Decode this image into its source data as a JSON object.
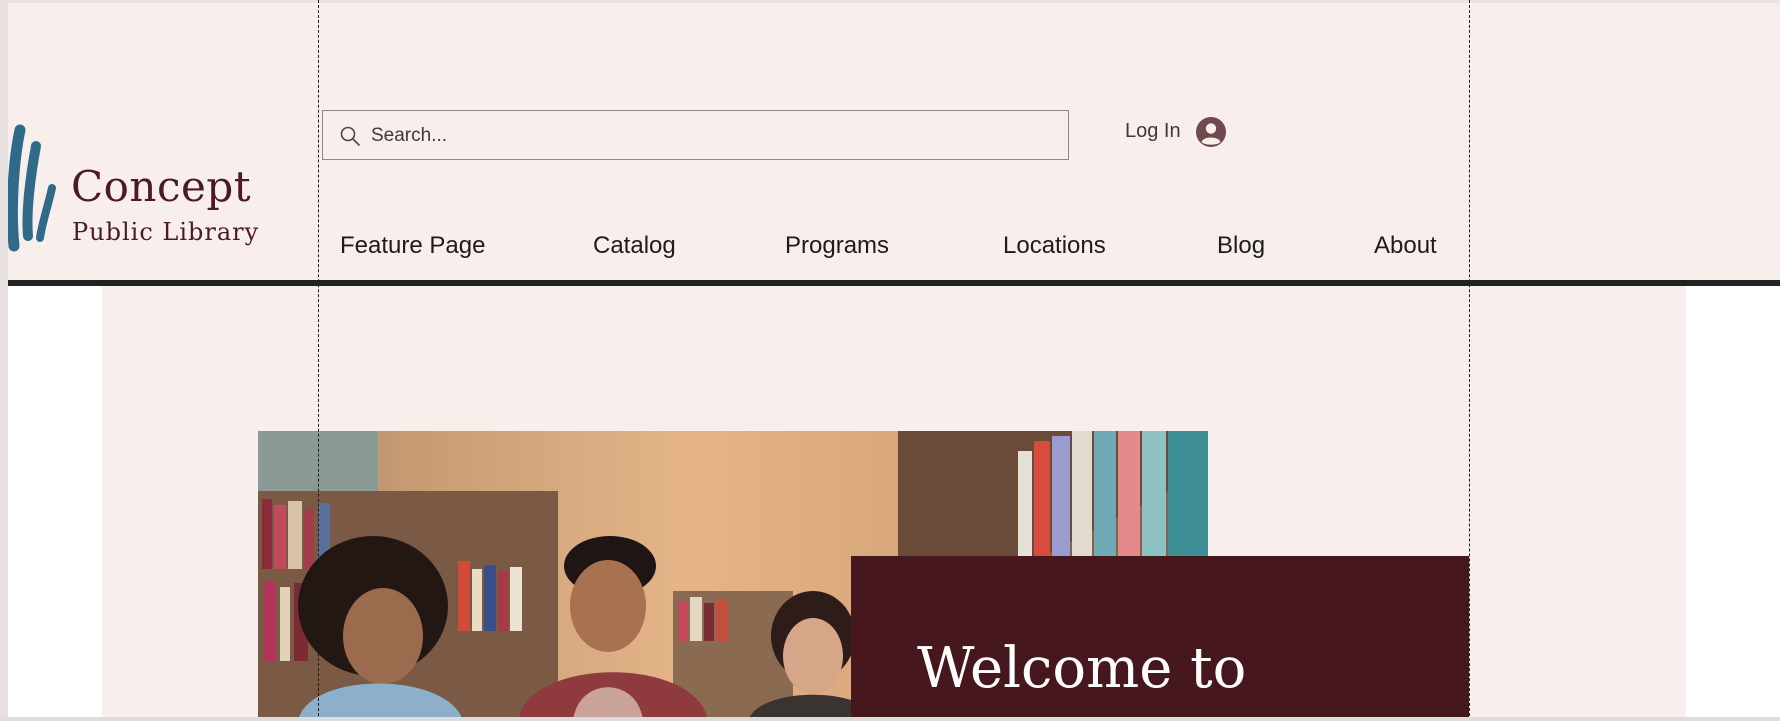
{
  "brand": {
    "title": "Concept",
    "subtitle": "Public Library"
  },
  "search": {
    "placeholder": "Search...",
    "value": ""
  },
  "account": {
    "login_label": "Log In"
  },
  "nav": {
    "items": [
      {
        "label": "Feature Page"
      },
      {
        "label": "Catalog"
      },
      {
        "label": "Programs"
      },
      {
        "label": "Locations"
      },
      {
        "label": "Blog"
      },
      {
        "label": "About"
      }
    ]
  },
  "hero": {
    "welcome_text": "Welcome to"
  },
  "colors": {
    "background": "#f8eeeb",
    "burgundy": "#47171e",
    "logo_blue": "#2f6b88",
    "rule": "#222222"
  },
  "icons": {
    "search": "search-icon",
    "user": "user-avatar-icon",
    "logo": "brush-strokes-logo-icon"
  }
}
